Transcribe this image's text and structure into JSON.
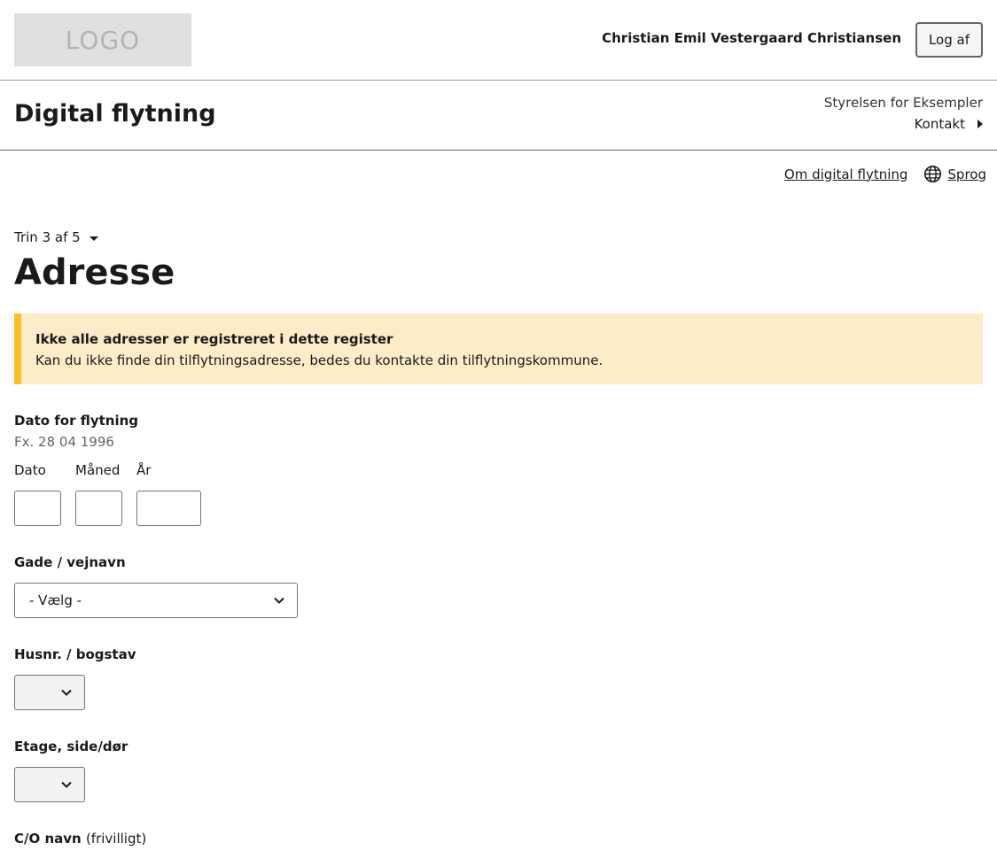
{
  "header": {
    "logo_text": "LOGO",
    "user_name": "Christian Emil Vestergaard Christiansen",
    "logout_label": "Log af"
  },
  "app": {
    "title": "Digital flytning",
    "authority": "Styrelsen for Eksempler",
    "contact_label": "Kontakt"
  },
  "nav": {
    "about_label": "Om digital flytning",
    "language_label": "Sprog",
    "language_icon": "globe-icon"
  },
  "step": {
    "label": "Trin 3 af 5"
  },
  "page": {
    "title": "Adresse"
  },
  "alert": {
    "title": "Ikke alle adresser er registreret i dette register",
    "text": "Kan du ikke finde din tilflytningsadresse, bedes du kontakte din tilflytningskommune.",
    "accent_color": "#ffbc2b",
    "background_color": "#fdecc8"
  },
  "form": {
    "move_date": {
      "label": "Dato for flytning",
      "hint": "Fx. 28 04 1996",
      "day_label": "Dato",
      "month_label": "Måned",
      "year_label": "År",
      "day_value": "",
      "month_value": "",
      "year_value": ""
    },
    "street": {
      "label": "Gade / vejnavn",
      "selected": "- Vælg -"
    },
    "house_number": {
      "label": "Husnr. / bogstav",
      "selected": ""
    },
    "floor": {
      "label": "Etage, side/dør",
      "selected": ""
    },
    "co_name": {
      "label": "C/O navn",
      "optional_text": "(frivilligt)"
    }
  }
}
